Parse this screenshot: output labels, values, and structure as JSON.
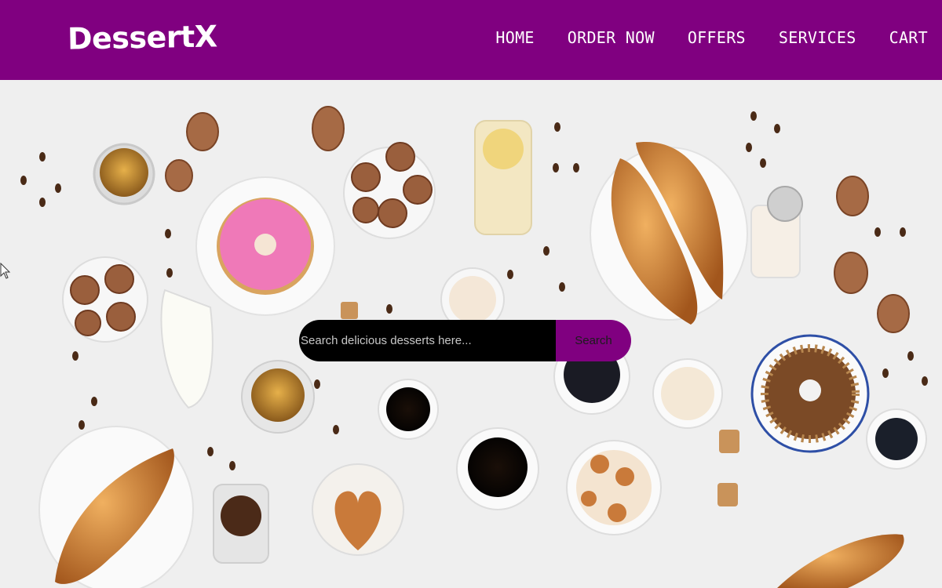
{
  "brand": {
    "name": "DessertX"
  },
  "nav": {
    "items": [
      {
        "label": "HOME"
      },
      {
        "label": "ORDER NOW"
      },
      {
        "label": "OFFERS"
      },
      {
        "label": "SERVICES"
      },
      {
        "label": "CART"
      }
    ]
  },
  "search": {
    "placeholder": "Search delicious desserts here...",
    "value": "",
    "button_label": "Search"
  },
  "colors": {
    "brand": "#800080",
    "search_field": "#000000"
  },
  "hero": {
    "image": "hero-dessert-table-photo"
  }
}
